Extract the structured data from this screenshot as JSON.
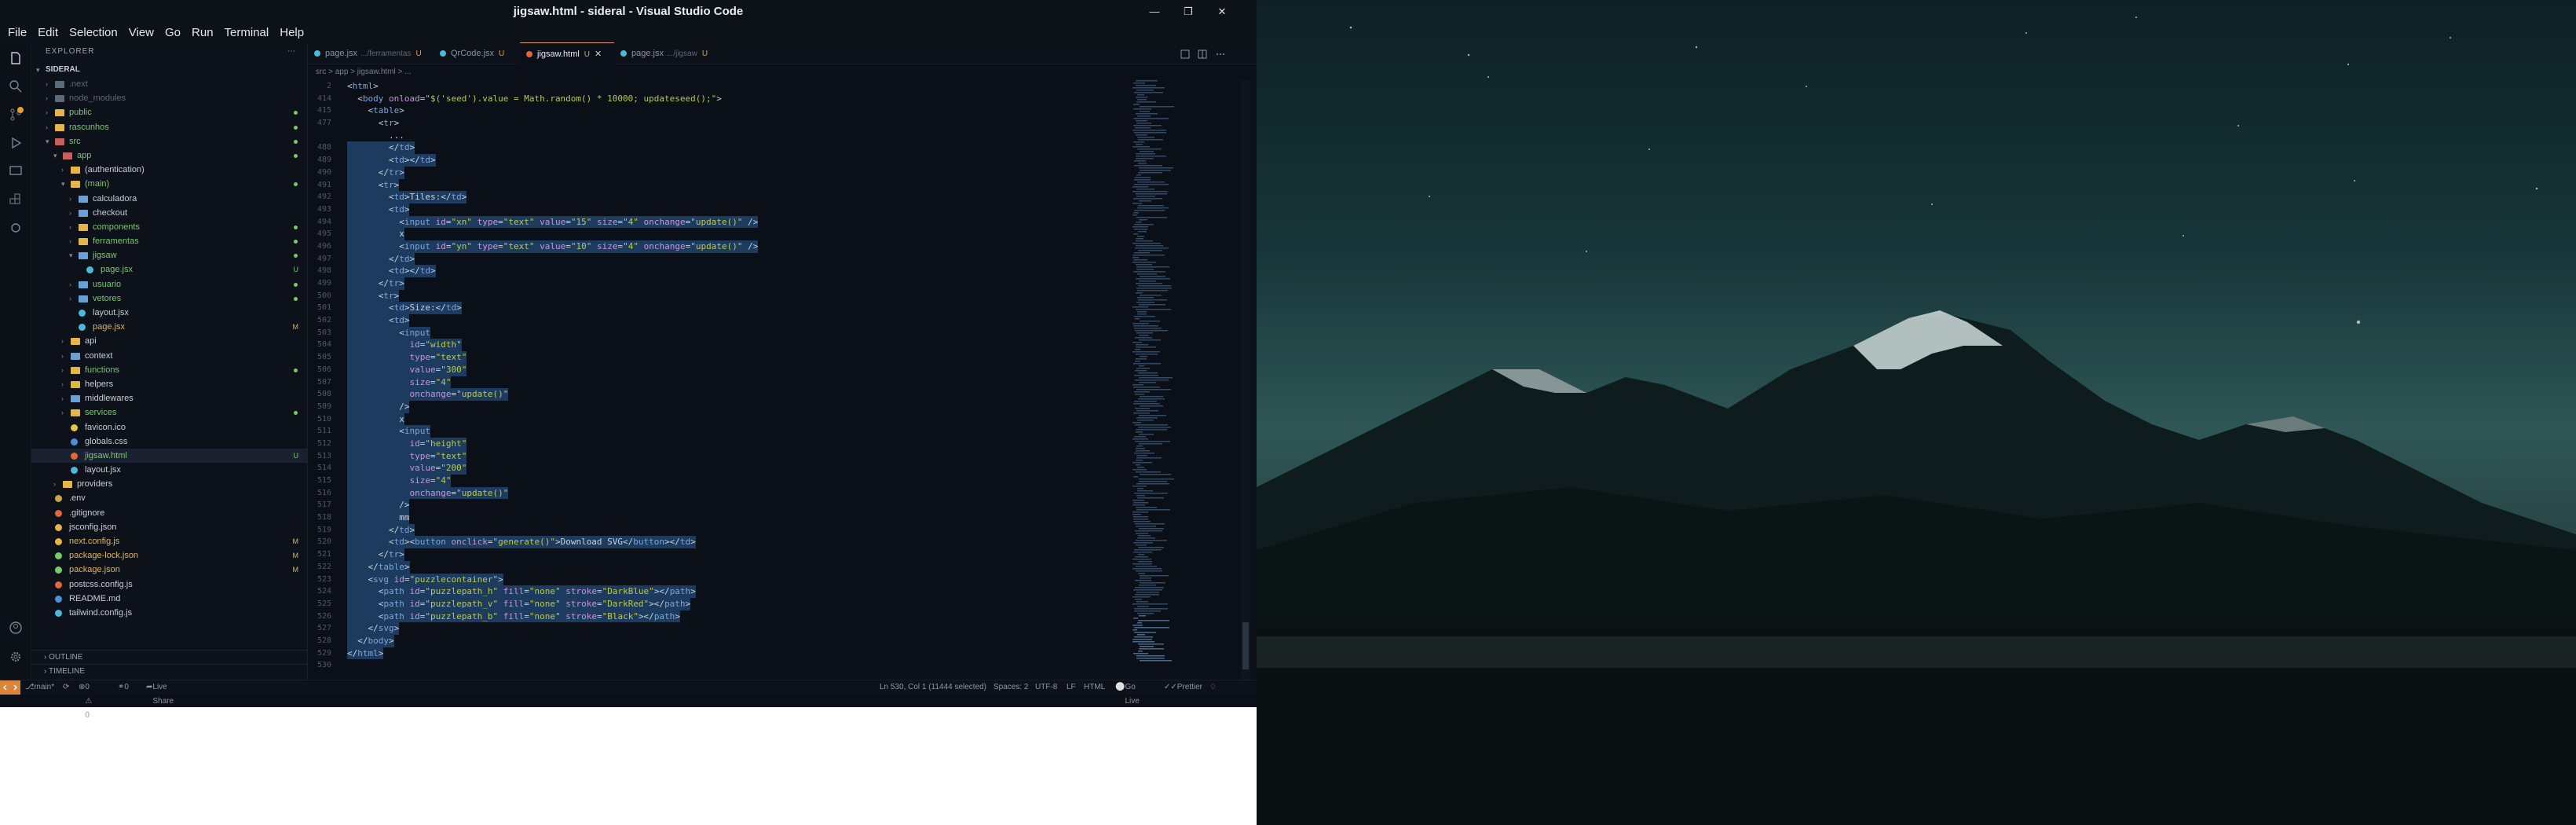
{
  "window": {
    "title": "jigsaw.html - sideral - Visual Studio Code"
  },
  "menu": [
    "File",
    "Edit",
    "Selection",
    "View",
    "Go",
    "Run",
    "Terminal",
    "Help"
  ],
  "explorer": {
    "header": "EXPLORER",
    "root": "SIDERAL",
    "outline": "OUTLINE",
    "timeline": "TIMELINE"
  },
  "tree": [
    {
      "label": ".next",
      "depth": 1,
      "kind": "folder",
      "dim": true,
      "color": "#5a6a7a"
    },
    {
      "label": "node_modules",
      "depth": 1,
      "kind": "folder",
      "dim": true,
      "color": "#5a6a7a"
    },
    {
      "label": "public",
      "depth": 1,
      "kind": "folder",
      "color": "#e6b54a",
      "status": "dot"
    },
    {
      "label": "rascunhos",
      "depth": 1,
      "kind": "folder",
      "color": "#e6b54a",
      "status": "dot"
    },
    {
      "label": "src",
      "depth": 1,
      "kind": "folder",
      "color": "#c85f5f",
      "open": true,
      "status": "dot"
    },
    {
      "label": "app",
      "depth": 2,
      "kind": "folder",
      "color": "#c85f5f",
      "open": true,
      "status": "dot"
    },
    {
      "label": "(authentication)",
      "depth": 3,
      "kind": "folder",
      "color": "#e6b54a"
    },
    {
      "label": "(main)",
      "depth": 3,
      "kind": "folder",
      "color": "#e6b54a",
      "open": true,
      "status": "dot"
    },
    {
      "label": "calculadora",
      "depth": 4,
      "kind": "folder",
      "color": "#6aa0d8"
    },
    {
      "label": "checkout",
      "depth": 4,
      "kind": "folder",
      "color": "#6aa0d8"
    },
    {
      "label": "components",
      "depth": 4,
      "kind": "folder",
      "color": "#e6b54a",
      "status": "dot"
    },
    {
      "label": "ferramentas",
      "depth": 4,
      "kind": "folder",
      "color": "#e6b54a",
      "status": "dot"
    },
    {
      "label": "jigsaw",
      "depth": 4,
      "kind": "folder",
      "color": "#6aa0d8",
      "open": true,
      "status": "dot"
    },
    {
      "label": "page.jsx",
      "depth": 5,
      "kind": "file",
      "color": "#4fb7d8",
      "status": "U"
    },
    {
      "label": "usuario",
      "depth": 4,
      "kind": "folder",
      "color": "#6aa0d8",
      "status": "dot"
    },
    {
      "label": "vetores",
      "depth": 4,
      "kind": "folder",
      "color": "#6aa0d8",
      "status": "dot"
    },
    {
      "label": "layout.jsx",
      "depth": 4,
      "kind": "file",
      "color": "#4fb7d8"
    },
    {
      "label": "page.jsx",
      "depth": 4,
      "kind": "file",
      "color": "#4fb7d8",
      "status": "M"
    },
    {
      "label": "api",
      "depth": 3,
      "kind": "folder",
      "color": "#e6b54a"
    },
    {
      "label": "context",
      "depth": 3,
      "kind": "folder",
      "color": "#6aa0d8"
    },
    {
      "label": "functions",
      "depth": 3,
      "kind": "folder",
      "color": "#e6b54a",
      "status": "dot"
    },
    {
      "label": "helpers",
      "depth": 3,
      "kind": "folder",
      "color": "#e6b54a"
    },
    {
      "label": "middlewares",
      "depth": 3,
      "kind": "folder",
      "color": "#6aa0d8"
    },
    {
      "label": "services",
      "depth": 3,
      "kind": "folder",
      "color": "#e6b54a",
      "status": "dot"
    },
    {
      "label": "favicon.ico",
      "depth": 3,
      "kind": "file",
      "color": "#e6c34a"
    },
    {
      "label": "globals.css",
      "depth": 3,
      "kind": "file",
      "color": "#4f8fd8"
    },
    {
      "label": "jigsaw.html",
      "depth": 3,
      "kind": "file",
      "color": "#e0673a",
      "status": "U",
      "selected": true
    },
    {
      "label": "layout.jsx",
      "depth": 3,
      "kind": "file",
      "color": "#4fb7d8"
    },
    {
      "label": "providers",
      "depth": 2,
      "kind": "folder",
      "color": "#e6b54a"
    },
    {
      "label": ".env",
      "depth": 1,
      "kind": "file",
      "color": "#c9a64a"
    },
    {
      "label": ".gitignore",
      "depth": 1,
      "kind": "file",
      "color": "#e0673a"
    },
    {
      "label": "jsconfig.json",
      "depth": 1,
      "kind": "file",
      "color": "#e6b54a"
    },
    {
      "label": "next.config.js",
      "depth": 1,
      "kind": "file",
      "color": "#e6b54a",
      "status": "M"
    },
    {
      "label": "package-lock.json",
      "depth": 1,
      "kind": "file",
      "color": "#7bc96f",
      "status": "M"
    },
    {
      "label": "package.json",
      "depth": 1,
      "kind": "file",
      "color": "#7bc96f",
      "status": "M"
    },
    {
      "label": "postcss.config.js",
      "depth": 1,
      "kind": "file",
      "color": "#e0673a"
    },
    {
      "label": "README.md",
      "depth": 1,
      "kind": "file",
      "color": "#4f8fd8"
    },
    {
      "label": "tailwind.config.js",
      "depth": 1,
      "kind": "file",
      "color": "#4fb7d8"
    }
  ],
  "tabs": [
    {
      "label": "page.jsx",
      "path": ".../ferramentas",
      "mod": "U",
      "color": "#4fb7d8",
      "active": false
    },
    {
      "label": "QrCode.jsx",
      "path": "",
      "mod": "U",
      "color": "#4fb7d8",
      "active": false
    },
    {
      "label": "jigsaw.html",
      "path": "",
      "mod": "U",
      "color": "#e0673a",
      "active": true
    },
    {
      "label": "page.jsx",
      "path": ".../jigsaw",
      "mod": "U",
      "color": "#4fb7d8",
      "active": false
    }
  ],
  "breadcrumbs": "src > app > jigsaw.html > ...",
  "code": [
    {
      "n": "2",
      "t": "<html>",
      "sel": false
    },
    {
      "n": "414",
      "t": "  <body onload=\"$('seed').value = Math.random() * 10000; updateseed();\">",
      "sel": false
    },
    {
      "n": "415",
      "t": "    <table>",
      "sel": false
    },
    {
      "n": "477",
      "t": "      <tr>",
      "sel": false
    },
    {
      "n": "",
      "t": "        ...",
      "sel": false
    },
    {
      "n": "488",
      "t": "        </td>",
      "sel": true
    },
    {
      "n": "489",
      "t": "        <td></td>",
      "sel": true
    },
    {
      "n": "490",
      "t": "      </tr>",
      "sel": true
    },
    {
      "n": "491",
      "t": "      <tr>",
      "sel": true
    },
    {
      "n": "492",
      "t": "        <td>Tiles:</td>",
      "sel": true
    },
    {
      "n": "493",
      "t": "        <td>",
      "sel": true
    },
    {
      "n": "494",
      "t": "          <input id=\"xn\" type=\"text\" value=\"15\" size=\"4\" onchange=\"update()\" />",
      "sel": true
    },
    {
      "n": "495",
      "t": "          x",
      "sel": true
    },
    {
      "n": "496",
      "t": "          <input id=\"yn\" type=\"text\" value=\"10\" size=\"4\" onchange=\"update()\" />",
      "sel": true
    },
    {
      "n": "497",
      "t": "        </td>",
      "sel": true
    },
    {
      "n": "498",
      "t": "        <td></td>",
      "sel": true
    },
    {
      "n": "499",
      "t": "      </tr>",
      "sel": true
    },
    {
      "n": "500",
      "t": "      <tr>",
      "sel": true
    },
    {
      "n": "501",
      "t": "        <td>Size:</td>",
      "sel": true
    },
    {
      "n": "502",
      "t": "        <td>",
      "sel": true
    },
    {
      "n": "503",
      "t": "          <input",
      "sel": true
    },
    {
      "n": "504",
      "t": "            id=\"width\"",
      "sel": true
    },
    {
      "n": "505",
      "t": "            type=\"text\"",
      "sel": true
    },
    {
      "n": "506",
      "t": "            value=\"300\"",
      "sel": true
    },
    {
      "n": "507",
      "t": "            size=\"4\"",
      "sel": true
    },
    {
      "n": "508",
      "t": "            onchange=\"update()\"",
      "sel": true
    },
    {
      "n": "509",
      "t": "          />",
      "sel": true
    },
    {
      "n": "510",
      "t": "          x",
      "sel": true
    },
    {
      "n": "511",
      "t": "          <input",
      "sel": true
    },
    {
      "n": "512",
      "t": "            id=\"height\"",
      "sel": true
    },
    {
      "n": "513",
      "t": "            type=\"text\"",
      "sel": true
    },
    {
      "n": "514",
      "t": "            value=\"200\"",
      "sel": true
    },
    {
      "n": "515",
      "t": "            size=\"4\"",
      "sel": true
    },
    {
      "n": "516",
      "t": "            onchange=\"update()\"",
      "sel": true
    },
    {
      "n": "517",
      "t": "          />",
      "sel": true
    },
    {
      "n": "518",
      "t": "          mm",
      "sel": true
    },
    {
      "n": "519",
      "t": "        </td>",
      "sel": true
    },
    {
      "n": "520",
      "t": "        <td><button onclick=\"generate()\">Download SVG</button></td>",
      "sel": true
    },
    {
      "n": "521",
      "t": "      </tr>",
      "sel": true
    },
    {
      "n": "522",
      "t": "    </table>",
      "sel": true
    },
    {
      "n": "523",
      "t": "    <svg id=\"puzzlecontainer\">",
      "sel": true
    },
    {
      "n": "524",
      "t": "      <path id=\"puzzlepath_h\" fill=\"none\" stroke=\"DarkBlue\"></path>",
      "sel": true
    },
    {
      "n": "525",
      "t": "      <path id=\"puzzlepath_v\" fill=\"none\" stroke=\"DarkRed\"></path>",
      "sel": true
    },
    {
      "n": "526",
      "t": "      <path id=\"puzzlepath_b\" fill=\"none\" stroke=\"Black\"></path>",
      "sel": true
    },
    {
      "n": "527",
      "t": "    </svg>",
      "sel": true
    },
    {
      "n": "528",
      "t": "  </body>",
      "sel": true
    },
    {
      "n": "529",
      "t": "</html>",
      "sel": true
    },
    {
      "n": "530",
      "t": "",
      "sel": false
    }
  ],
  "status": {
    "branch": "main*",
    "problems": "0 ⚠ 0",
    "ports": "0",
    "live_share": "Live Share",
    "position": "Ln 530, Col 1 (11444 selected)",
    "spaces": "Spaces: 2",
    "encoding": "UTF-8",
    "eol": "LF",
    "language": "HTML",
    "go_live": "Go Live",
    "prettier": "Prettier"
  }
}
